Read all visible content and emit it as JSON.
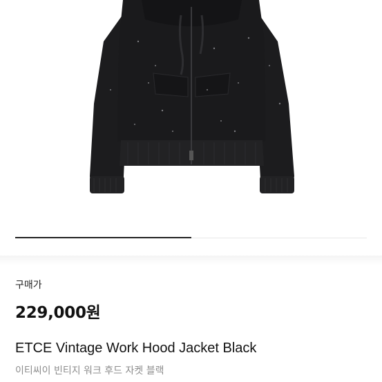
{
  "product": {
    "image_alt": "ETCE Vintage Work Hood Jacket Black",
    "image_progress": 0.5,
    "price_label": "구매가",
    "price": "229,000원",
    "title_en": "ETCE Vintage Work Hood Jacket Black",
    "title_ko": "이티씨이 빈티지 워크 후드 자켓 블랙"
  },
  "colors": {
    "jacket": "#1c1c1e",
    "text_primary": "#111111",
    "text_secondary": "#8c8c8c",
    "progress_active": "#222222",
    "progress_track": "#e6e6e6"
  }
}
